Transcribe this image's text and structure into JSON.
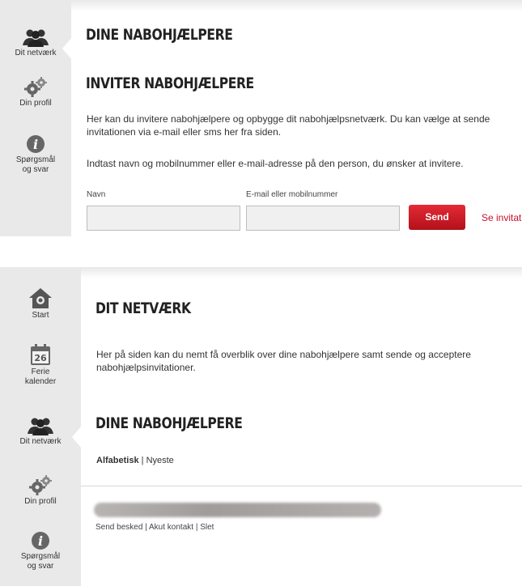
{
  "panel1": {
    "nav": [
      {
        "label": "Dit netværk",
        "icon": "people-icon"
      },
      {
        "label": "Din profil",
        "icon": "gears-icon"
      },
      {
        "label_line1": "Spørgsmål",
        "label_line2": "og svar",
        "icon": "info-icon"
      }
    ],
    "page_title": "DINE NABOHJÆLPERE",
    "section_title": "INVITER NABOHJÆLPERE",
    "intro": "Her kan du invitere nabohjælpere og opbygge dit nabohjælpsnetværk. Du kan vælge at sende invitationen via e-mail eller sms her fra siden.",
    "instruction": "Indtast navn og mobilnummer eller e-mail-adresse på den person, du ønsker at invitere.",
    "form": {
      "name_label": "Navn",
      "name_value": "",
      "contact_label": "E-mail eller mobilnummer",
      "contact_value": "",
      "send_label": "Send",
      "see_link": "Se invitatio"
    }
  },
  "panel2": {
    "nav": [
      {
        "label": "Start",
        "icon": "home-icon"
      },
      {
        "label_line1": "Ferie",
        "label_line2": "kalender",
        "icon": "calendar-icon",
        "calendar_day": "26"
      },
      {
        "label": "Dit netværk",
        "icon": "people-icon"
      },
      {
        "label": "Din profil",
        "icon": "gears-icon"
      },
      {
        "label_line1": "Spørgsmål",
        "label_line2": "og svar",
        "icon": "info-icon"
      }
    ],
    "page_title": "DIT NETVÆRK",
    "intro": "Her på siden kan du nemt få overblik over dine nabohjælpere samt sende og acceptere nabohjælpsinvitationer.",
    "section_title": "DINE NABOHJÆLPERE",
    "sort": {
      "active": "Alfabetisk",
      "separator": "|",
      "other": "Nyeste"
    },
    "contact_actions": {
      "send": "Send besked",
      "urgent": "Akut kontakt",
      "delete": "Slet",
      "separator": "|"
    }
  },
  "colors": {
    "accent": "#c8102e",
    "sidebar": "#e9e9e9",
    "icon": "#555555"
  }
}
